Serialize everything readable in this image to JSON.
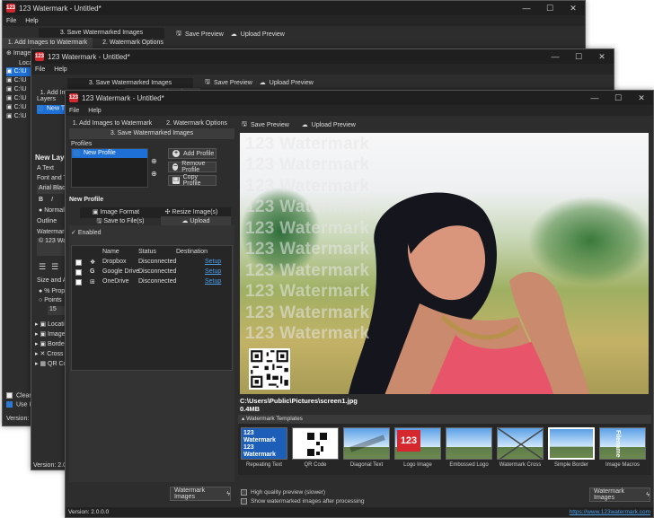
{
  "app": {
    "title": "123 Watermark - Untitled*",
    "icon_text": "123",
    "version": "Version: 2.0.0.0",
    "website": "https://www.123watermark.com"
  },
  "menu": {
    "file": "File",
    "help": "Help"
  },
  "window_controls": {
    "minimize": "—",
    "maximize": "☐",
    "close": "✕"
  },
  "tabs": {
    "add_images": "1. Add Images to Watermark",
    "watermark_options": "2. Watermark Options",
    "save_images": "3. Save Watermarked Images"
  },
  "toolbar": {
    "save_preview": "Save Preview",
    "upload_preview": "Upload Preview"
  },
  "back_window": {
    "images_label": "Image",
    "location_label": "Locat",
    "file_prefix": "C:\\U",
    "clear_label": "Clear Im",
    "use_label": "Use Ima",
    "version": "Version: 2.0.0"
  },
  "mid_window": {
    "layers_label": "Layers",
    "layer_item": "New T",
    "new_layer": "New Layer",
    "text_tool": "Text",
    "font_label": "Font and Text",
    "font_value": "Arial Black",
    "bold": "B",
    "italic": "I",
    "normal": "Normal",
    "outline": "Outline",
    "watermark_label": "Watermark",
    "watermark_value": "© 123 Wat",
    "size_label": "Size and Ang",
    "proportional": "% Propor",
    "points": "Points",
    "size_value": "15",
    "sections": [
      "Locati",
      "Image",
      "Borde",
      "Cross",
      "QR Co"
    ],
    "version": "Version: 2.0.0.0"
  },
  "profiles": {
    "label": "Profiles",
    "items": [
      {
        "name": "New Profile",
        "checked": true
      }
    ],
    "add": "Add Profile",
    "remove": "Remove Profile",
    "copy": "Copy Profile",
    "section_title": "New Profile"
  },
  "profile_tabs": {
    "image_format": "Image Format",
    "resize": "Resize Image(s)",
    "save_to_file": "Save to File(s)",
    "upload": "Upload"
  },
  "upload": {
    "enabled_label": "Enabled",
    "columns": [
      "Name",
      "Status",
      "Destination"
    ],
    "rows": [
      {
        "name": "Dropbox",
        "status": "Disconnected",
        "destination": "Setup"
      },
      {
        "name": "Google Drive",
        "status": "Disconnected",
        "destination": "Setup"
      },
      {
        "name": "OneDrive",
        "status": "Disconnected",
        "destination": "Setup"
      }
    ]
  },
  "preview": {
    "watermark_text": "123 Watermark",
    "file_path": "C:\\Users\\Public\\Pictures\\screen1.jpg",
    "file_size": "0.4MB"
  },
  "templates": {
    "header": "Watermark Templates",
    "items": [
      {
        "label": "Repeating Text"
      },
      {
        "label": "QR Code"
      },
      {
        "label": "Diagonal Text"
      },
      {
        "label": "Logo Image"
      },
      {
        "label": "Embossed Logo"
      },
      {
        "label": "Watermark Cross"
      },
      {
        "label": "Simple Border"
      },
      {
        "label": "Image Macros"
      }
    ],
    "thumb_text": "123 Watermark",
    "logo_text": "123",
    "macro_text": "Filename"
  },
  "bottom": {
    "high_quality": "High quality preview (slower)",
    "show_after": "Show watermarked images after processing",
    "watermark_button": "Watermark Images"
  },
  "colors": {
    "accent": "#1e6fd6",
    "brand": "#d4272e",
    "link": "#4a9de8"
  }
}
